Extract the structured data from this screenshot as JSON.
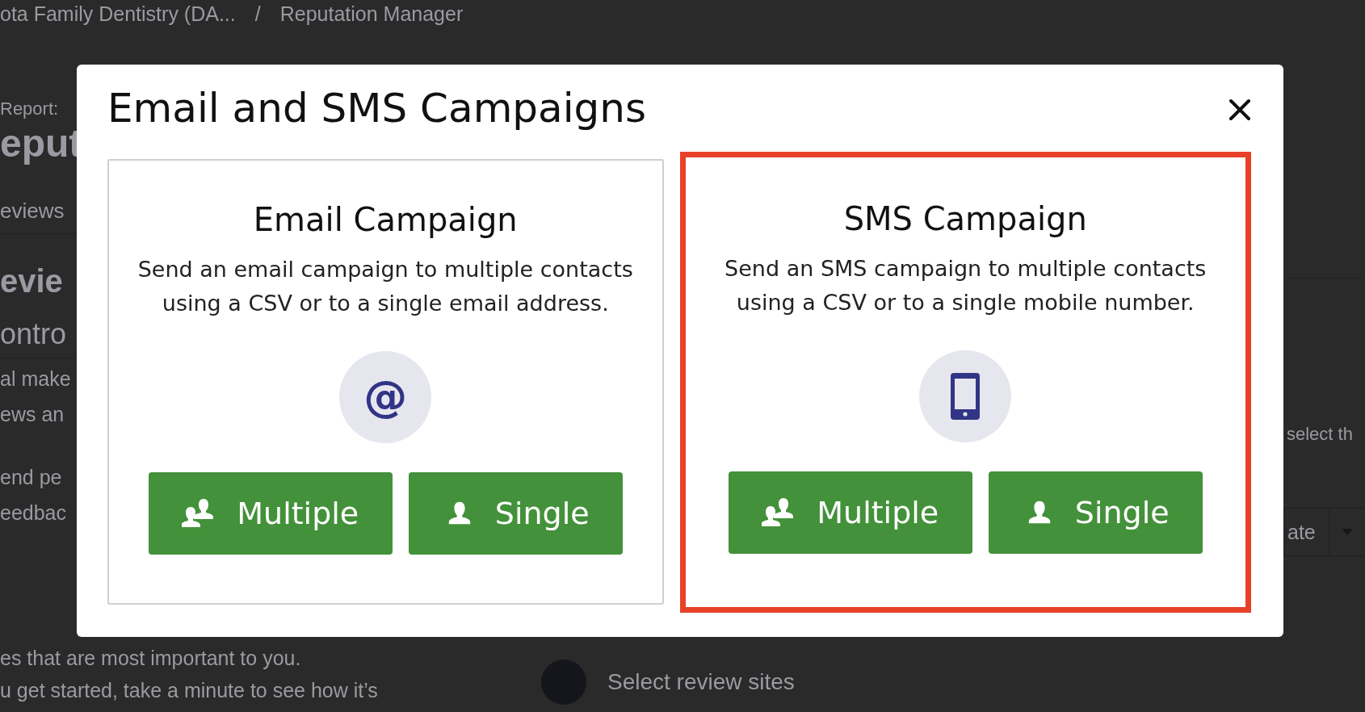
{
  "breadcrumb": {
    "items": [
      {
        "label": "ota Family Dentistry (DA..."
      },
      {
        "label": "Reputation Manager"
      }
    ],
    "separator": "/"
  },
  "background_left": [
    {
      "kind": "label",
      "text": "Report:"
    },
    {
      "kind": "title",
      "text": "eput"
    },
    {
      "kind": "tab",
      "text": "eviews"
    },
    {
      "kind": "heading",
      "text": "evie"
    },
    {
      "kind": "subheading",
      "text": "ontro"
    },
    {
      "kind": "text",
      "text": "al make"
    },
    {
      "kind": "text",
      "text": "ews an"
    },
    {
      "kind": "gap",
      "text": "end pe"
    },
    {
      "kind": "text",
      "text": "eedbac"
    }
  ],
  "background_right": {
    "text": "select th",
    "dropdown": "ate"
  },
  "background_bottom": {
    "lines": [
      "es that are most important to you.",
      "u get started, take a minute to see how it’s"
    ],
    "step_label": "Select review sites"
  },
  "modal": {
    "title": "Email and SMS Campaigns",
    "cards": [
      {
        "kind": "email",
        "highlighted": false,
        "title": "Email Campaign",
        "symbol": "@",
        "description_lines": [
          "Send an email campaign to multiple contacts",
          "using a CSV or to a single email address."
        ],
        "buttons": [
          {
            "kind": "multiple",
            "label": "Multiple"
          },
          {
            "kind": "single",
            "label": "Single"
          }
        ]
      },
      {
        "kind": "sms",
        "highlighted": true,
        "title": "SMS Campaign",
        "description_lines": [
          "Send an SMS campaign to multiple contacts",
          "using a CSV or to a single mobile number."
        ],
        "buttons": [
          {
            "kind": "multiple",
            "label": "Multiple"
          },
          {
            "kind": "single",
            "label": "Single"
          }
        ]
      }
    ]
  }
}
